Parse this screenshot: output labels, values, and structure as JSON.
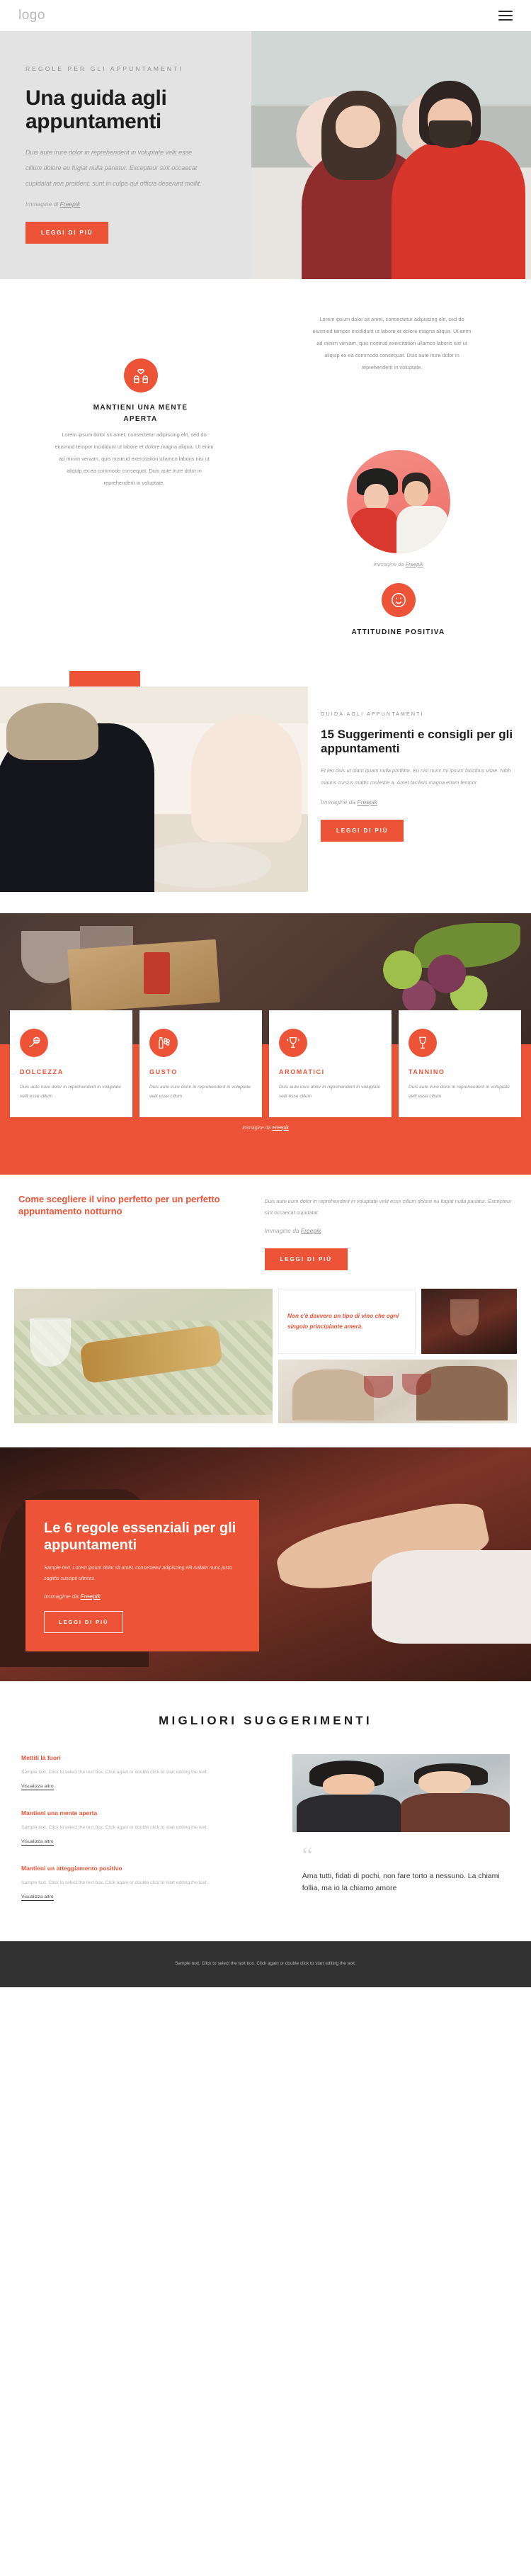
{
  "header": {
    "logo": "logo",
    "menu_icon": "hamburger-menu-icon"
  },
  "hero": {
    "eyebrow": "REGOLE PER GLI APPUNTAMENTI",
    "title": "Una guida agli appuntamenti",
    "body": "Duis aute irure dolor in reprehenderit in voluptate velit esse cillum dolore eu fugiat nulla pariatur. Excepteur sint occaecat cupidatat non proident, sunt in culpa qui officia deserunt mollit.",
    "credit_prefix": "Immagine di ",
    "credit_link": "Freepik",
    "cta": "LEGGI DI PIÙ",
    "bg_color": "#e3e3e3"
  },
  "values": {
    "left_card": {
      "icon": "couple-heart-icon",
      "title": "MANTIENI UNA MENTE APERTA"
    },
    "right_text": "Lorem ipsum dolor sit amet, consectetur adipiscing elit, sed do eiusmod tempor incididunt ut labore et dolore magna aliqua. Ut enim ad minim veniam, quis nostrud exercitation ullamco laboris nisi ut aliquip ex ea commodo consequat. Duis aute irure dolor in reprehenderit in voluptate.",
    "bottom_text": "Lorem ipsum dolor sit amet, consectetur adipiscing elit, sed do eiusmod tempor incididunt ut labore et dolore magna aliqua. Ut enim ad minim veniam, quis nostrud exercitation ullamco laboris nisi ut aliquip ex ea commodo consequat. Duis aute irure dolor in reprehenderit in voluptate.",
    "photo_credit_prefix": "Immagine da ",
    "photo_credit_link": "Freepik",
    "right_card": {
      "icon": "smiling-face-icon",
      "title": "ATTITUDINE POSITIVA"
    }
  },
  "tips15": {
    "eyebrow": "GUIDA AGLI APPUNTAMENTI",
    "title": "15 Suggerimenti e consigli per gli appuntamenti",
    "body": "Et leo duis ut diam quam nulla porttitor. Eu nisl nunc mi ipsum faucibus vitae. Nibh mauris cursus mattis molestie a. Amet facilisis magna etiam tempor.",
    "credit_prefix": "Immagine da ",
    "credit_link": "Freepik",
    "cta": "LEGGI DI PIÙ"
  },
  "cards": {
    "items": [
      {
        "icon": "honey-dipper-icon",
        "title": "DOLCEZZA",
        "body": "Duis aute irure dolor in reprehenderit in voluptate velit esse cillum"
      },
      {
        "icon": "bottle-grapes-icon",
        "title": "GUSTO",
        "body": "Duis aute irure dolor in reprehenderit in voluptate velit esse cillum"
      },
      {
        "icon": "wine-aroma-icon",
        "title": "AROMATICI",
        "body": "Duis aute irure dolor in reprehenderit in voluptate velit esse cillum"
      },
      {
        "icon": "wine-glass-icon",
        "title": "TANNINO",
        "body": "Duis aute irure dolor in reprehenderit in voluptate velit esse cillum"
      }
    ],
    "credit_prefix": "Immagine da ",
    "credit_link": "Freepik"
  },
  "winechoose": {
    "title": "Come scegliere il vino perfetto per un perfetto appuntamento notturno",
    "body": "Duis aute irure dolor in reprehenderit in voluptate velit esse cillum dolore eu fugiat nulla pariatur. Excepteur sint occaecat cupidatat.",
    "credit_prefix": "Immagine da ",
    "credit_link": "Freepik",
    "cta": "LEGGI DI PIÙ",
    "quote": "Non c'è davvero un tipo di vino che ogni singolo principiante amerà."
  },
  "rules": {
    "title": "Le 6 regole essenziali per gli appuntamenti",
    "body": "Sample text. Lorem ipsum dolor sit amet, consectetur adipiscing elit nullam nunc justo sagittis suscipit ultrices.",
    "credit_prefix": "Immagine da ",
    "credit_link": "Freepik",
    "cta": "LEGGI DI PIÙ"
  },
  "best": {
    "title": "MIGLIORI SUGGERIMENTI",
    "items": [
      {
        "title": "Mettiti là fuori",
        "body": "Sample text. Click to select the text box. Click again or double click to start editing the text.",
        "link": "Visualizza altro"
      },
      {
        "title": "Mantieni una mente aperta",
        "body": "Sample text. Click to select the text box. Click again or double click to start editing the text.",
        "link": "Visualizza altro"
      },
      {
        "title": "Mantieni un atteggiamento positivo",
        "body": "Sample text. Click to select the text box. Click again or double click to start editing the text.",
        "link": "Visualizza altro"
      }
    ],
    "quote_mark": "“",
    "quote": "Ama tutti, fidati di pochi, non fare torto a nessuno. La chiami follia, ma io la chiamo amore"
  },
  "footer": {
    "text": "Sample text. Click to select the text box. Click again or double click to start editing the text."
  },
  "colors": {
    "accent": "#ec5337",
    "hero_bg": "#e3e3e3",
    "footer_bg": "#323232"
  }
}
